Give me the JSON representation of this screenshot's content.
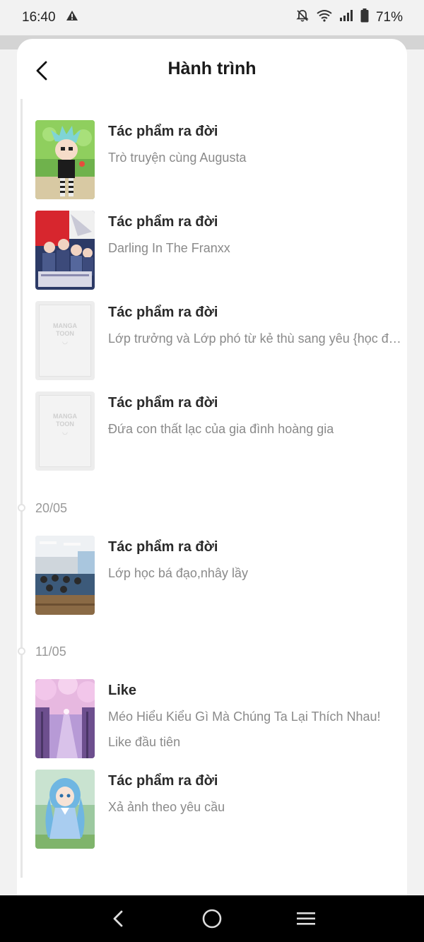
{
  "status_bar": {
    "time": "16:40",
    "battery": "71%",
    "icons": [
      "warning-icon",
      "bell-off-icon",
      "wifi-icon",
      "signal-icon",
      "battery-icon"
    ]
  },
  "header": {
    "title": "Hành trình",
    "back_icon": "chevron-left-icon"
  },
  "timeline": {
    "groups": [
      {
        "date": "",
        "items": [
          {
            "title": "Tác phẩm ra đời",
            "subtitle": "Trò truyện cùng Augusta",
            "thumb": "anime-girl-chibi"
          },
          {
            "title": "Tác phẩm ra đời",
            "subtitle": "Darling In The Franxx",
            "thumb": "anime-group-red"
          },
          {
            "title": "Tác phẩm ra đời",
            "subtitle": "Lớp trưởng và Lớp phó từ kẻ thù sang yêu {học đường}",
            "thumb": "mangatoon-placeholder"
          },
          {
            "title": "Tác phẩm ra đời",
            "subtitle": "Đứa con thất lạc của gia đình hoàng gia",
            "thumb": "mangatoon-placeholder"
          }
        ]
      },
      {
        "date": "20/05",
        "items": [
          {
            "title": "Tác phẩm ra đời",
            "subtitle": "Lớp học bá đạo,nhây lầy",
            "thumb": "classroom-photo"
          }
        ]
      },
      {
        "date": "11/05",
        "items": [
          {
            "title": "Like",
            "subtitle": "Méo Hiểu Kiểu Gì Mà Chúng Ta Lại Thích Nhau!",
            "subtitle2": "Like đầu tiên",
            "thumb": "sakura-path"
          },
          {
            "title": "Tác phẩm ra đời",
            "subtitle": "Xả ảnh theo yêu cầu",
            "thumb": "anime-girl-blue"
          }
        ]
      }
    ]
  },
  "placeholder_logo": {
    "line1": "MANGA",
    "line2": "TOON"
  },
  "nav_bar": {
    "icons": [
      "back-nav-icon",
      "home-nav-icon",
      "menu-nav-icon"
    ]
  }
}
